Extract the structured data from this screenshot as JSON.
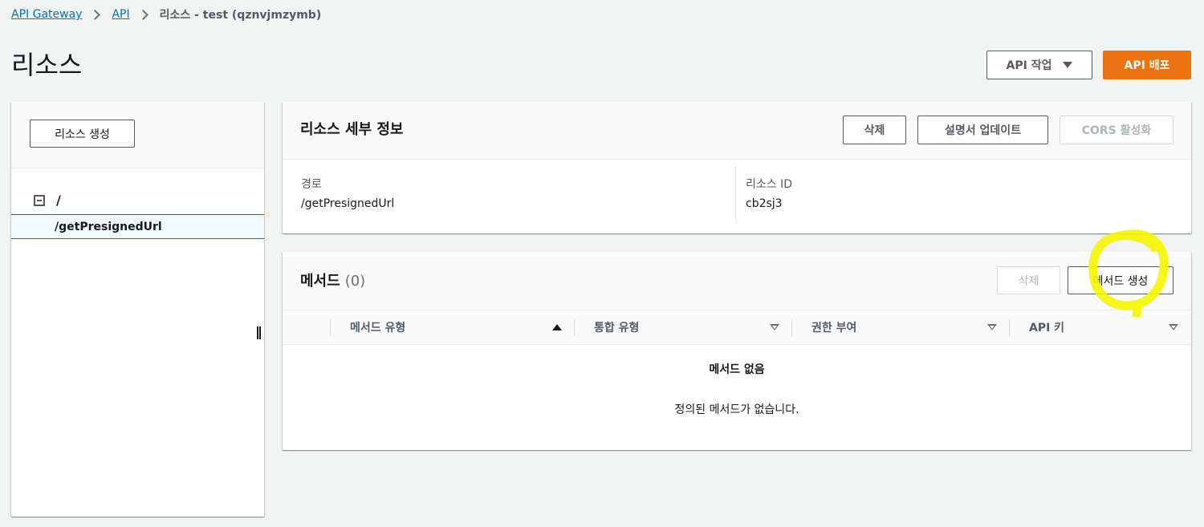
{
  "breadcrumb": {
    "items": [
      "API Gateway",
      "API"
    ],
    "current": "리소스 - test (qznvjmzymb)"
  },
  "page": {
    "title": "리소스"
  },
  "header_actions": {
    "api_actions_label": "API 작업",
    "deploy_label": "API 배포"
  },
  "sidebar": {
    "create_resource_label": "리소스 생성",
    "tree_root": "/",
    "tree_selected": "/getPresignedUrl"
  },
  "resource_details": {
    "title": "리소스 세부 정보",
    "delete_label": "삭제",
    "update_doc_label": "설명서 업데이트",
    "cors_label": "CORS 활성화",
    "path_label": "경로",
    "path_value": "/getPresignedUrl",
    "id_label": "리소스 ID",
    "id_value": "cb2sj3"
  },
  "methods": {
    "title": "메서드",
    "count": "(0)",
    "delete_label": "삭제",
    "create_label": "메서드 생성",
    "columns": [
      "메서드 유형",
      "통합 유형",
      "권한 부여",
      "API 키"
    ],
    "empty_title": "메서드 없음",
    "empty_desc": "정의된 메서드가 없습니다."
  },
  "colors": {
    "primary": "#ec7211",
    "link": "#0073bb",
    "highlight": "#f5f500"
  }
}
